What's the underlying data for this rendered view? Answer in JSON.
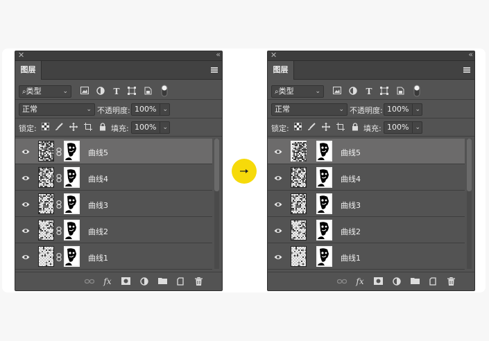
{
  "panels": [
    {
      "tab_label": "图层",
      "filter": {
        "label": "类型"
      },
      "blend_mode": "正常",
      "opacity_label": "不透明度:",
      "opacity_value": "100%",
      "lock_label": "锁定:",
      "fill_label": "填充:",
      "fill_value": "100%",
      "layers": [
        {
          "name": "曲线5",
          "selected": true
        },
        {
          "name": "曲线4",
          "selected": false
        },
        {
          "name": "曲线3",
          "selected": false
        },
        {
          "name": "曲线2",
          "selected": false
        },
        {
          "name": "曲线1",
          "selected": false
        }
      ],
      "mask_linked": true
    },
    {
      "tab_label": "图层",
      "filter": {
        "label": "类型"
      },
      "blend_mode": "正常",
      "opacity_label": "不透明度:",
      "opacity_value": "100%",
      "lock_label": "锁定:",
      "fill_label": "填充:",
      "fill_value": "100%",
      "layers": [
        {
          "name": "曲线5",
          "selected": true
        },
        {
          "name": "曲线4",
          "selected": false
        },
        {
          "name": "曲线3",
          "selected": false
        },
        {
          "name": "曲线2",
          "selected": false
        },
        {
          "name": "曲线1",
          "selected": false
        }
      ],
      "mask_linked": false
    }
  ],
  "icons": {
    "filter_buttons": [
      "image-filter-icon",
      "adjustment-filter-icon",
      "type-filter-icon",
      "shape-filter-icon",
      "smart-object-filter-icon",
      "filter-toggle-icon"
    ],
    "lock_buttons": [
      "lock-transparent-pixels-icon",
      "lock-image-pixels-icon",
      "lock-position-icon",
      "lock-artboard-icon",
      "lock-all-icon"
    ],
    "footer_buttons": [
      "link-layers-icon",
      "fx-icon",
      "add-mask-icon",
      "new-adjustment-icon",
      "new-group-icon",
      "new-layer-icon",
      "delete-layer-icon"
    ]
  },
  "colors": {
    "panel_bg": "#535353",
    "selected_row": "#6c6b6b",
    "accent_yellow": "#f6da0a"
  }
}
